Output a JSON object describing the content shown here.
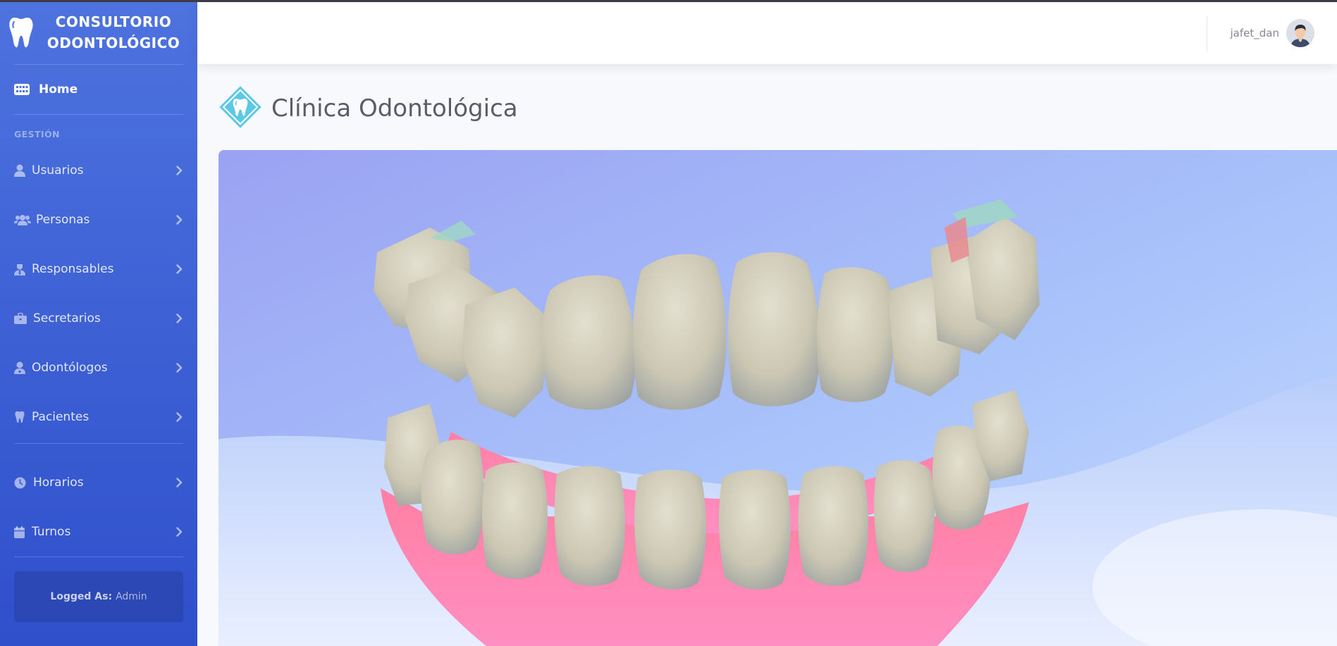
{
  "app": {
    "brand_line1": "CONSULTORIO",
    "brand_line2": "ODONTOLÓGICO",
    "brand_icon": "tooth-icon"
  },
  "sidebar": {
    "home": {
      "label": "Home",
      "icon": "dashboard-icon"
    },
    "section_heading": "GESTIÓN",
    "items": [
      {
        "label": "Usuarios",
        "icon": "user-icon"
      },
      {
        "label": "Personas",
        "icon": "users-icon"
      },
      {
        "label": "Responsables",
        "icon": "person-tie-icon"
      },
      {
        "label": "Secretarios",
        "icon": "briefcase-icon"
      },
      {
        "label": "Odontólogos",
        "icon": "user-doctor-icon"
      },
      {
        "label": "Pacientes",
        "icon": "tooth-icon"
      }
    ],
    "items2": [
      {
        "label": "Horarios",
        "icon": "clock-icon"
      },
      {
        "label": "Turnos",
        "icon": "calendar-icon"
      }
    ],
    "logged_label": "Logged As:",
    "logged_value": "Admin"
  },
  "topbar": {
    "username": "jafet_dan"
  },
  "main": {
    "title": "Clínica Odontológica",
    "logo_icon": "clinic-tooth-logo-icon",
    "hero_image": "3d-teeth-model-illustration"
  },
  "colors": {
    "sidebar_top": "#4e73df",
    "sidebar_bottom": "#2f4fcb",
    "background": "#f8f9fc",
    "title_text": "#5a5c69",
    "logo_accent": "#5bc8e6",
    "gum_pink": "#ff7fa3"
  }
}
